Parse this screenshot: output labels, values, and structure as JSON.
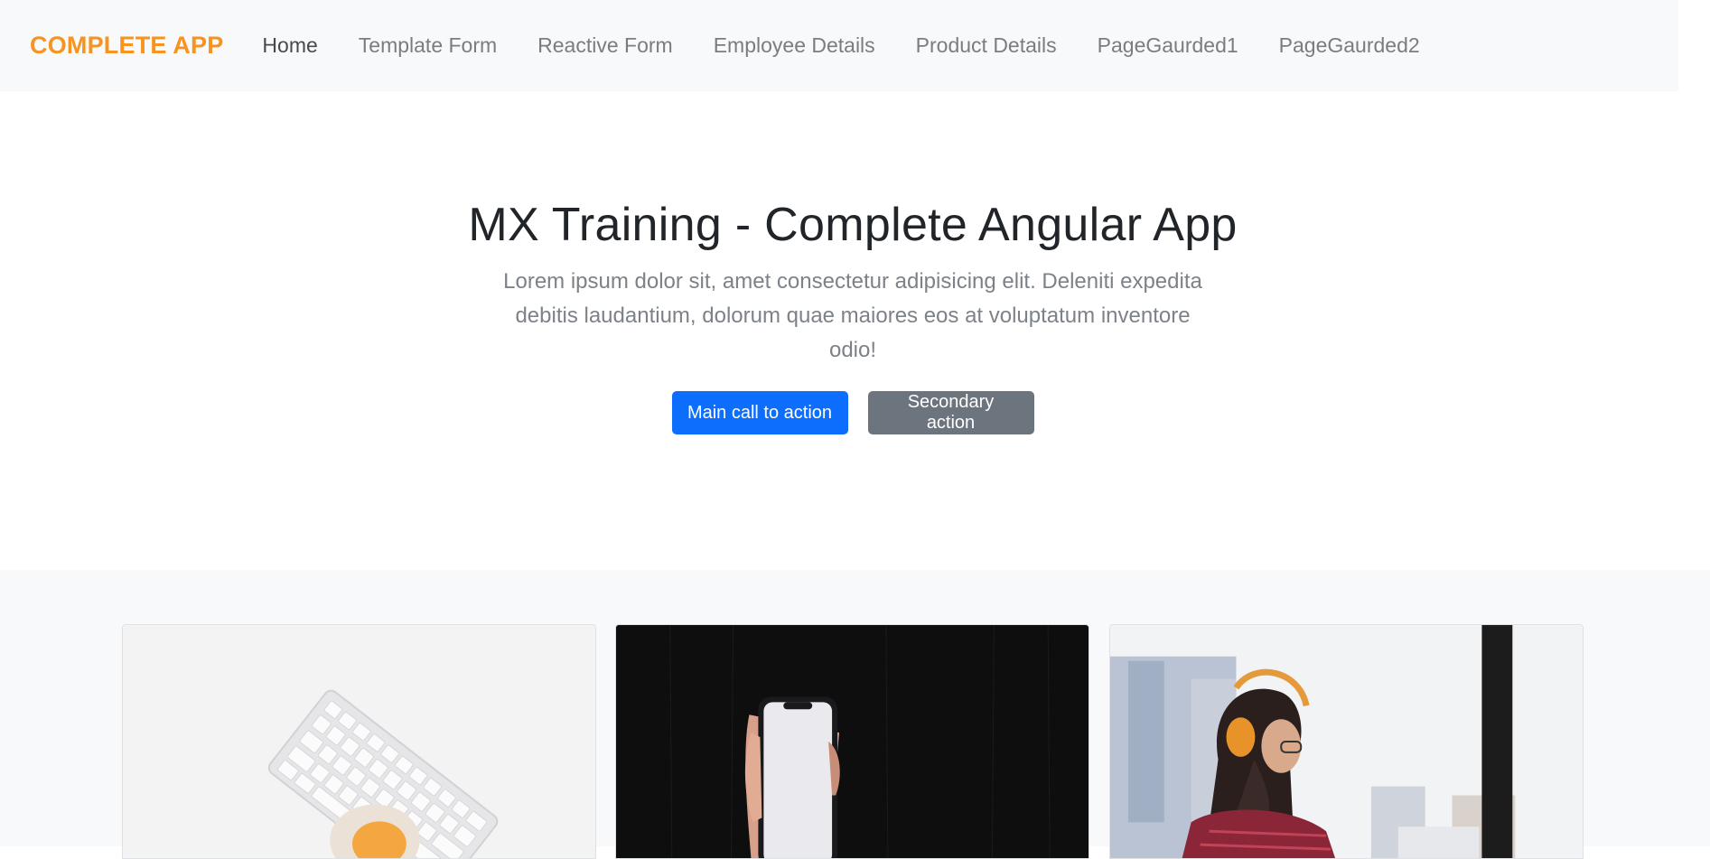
{
  "navbar": {
    "brand": "COMPLETE APP",
    "links": [
      {
        "label": "Home",
        "active": true
      },
      {
        "label": "Template Form"
      },
      {
        "label": "Reactive Form"
      },
      {
        "label": "Employee Details"
      },
      {
        "label": "Product Details"
      },
      {
        "label": "PageGaurded1"
      },
      {
        "label": "PageGaurded2"
      }
    ]
  },
  "hero": {
    "title": "MX Training - Complete Angular App",
    "lead": "Lorem ipsum dolor sit, amet consectetur adipisicing elit. Deleniti expedita debitis laudantium, dolorum quae maiores eos at voluptatum inventore odio!",
    "primary_button": "Main call to action",
    "secondary_button": "Secondary action"
  },
  "colors": {
    "brand": "#f7931e",
    "primary": "#0d6efd",
    "secondary": "#6c757d",
    "navbar_bg": "#f8f9fa"
  },
  "cards": [
    {
      "image": "keyboard-on-desk-photo"
    },
    {
      "image": "hand-holding-phone-photo"
    },
    {
      "image": "woman-with-headphones-photo"
    }
  ]
}
